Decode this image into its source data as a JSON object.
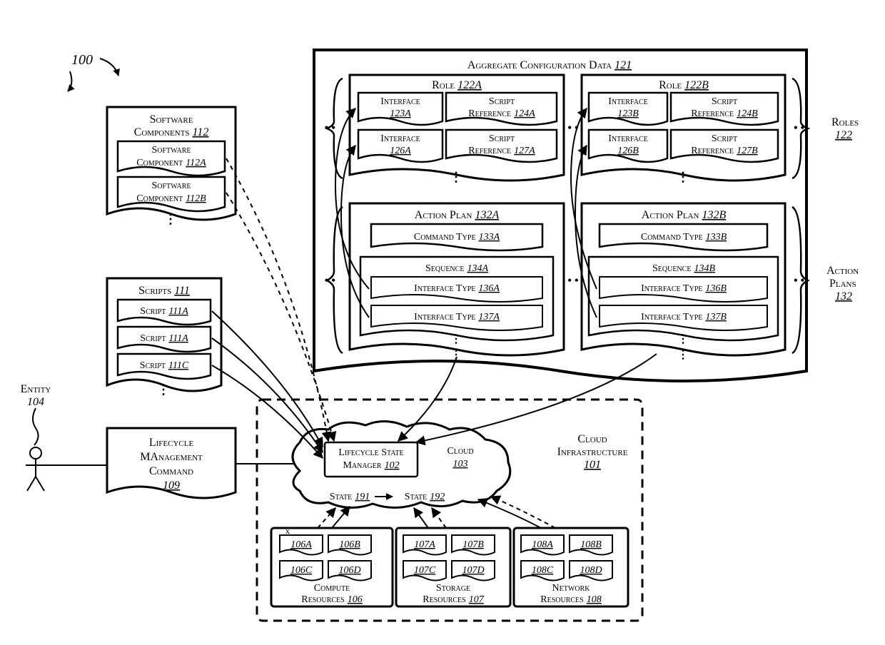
{
  "figure_number_label": "100",
  "entity": {
    "label": "Entity",
    "ref": "104"
  },
  "lifecycle_cmd": {
    "line1": "Lifecycle",
    "line2": "MAnagement",
    "line3": "Command",
    "ref": "109"
  },
  "software_components": {
    "title": "Software",
    "title2": "Components",
    "ref": "112",
    "items": [
      {
        "label1": "Software",
        "label2": "Component",
        "ref": "112A"
      },
      {
        "label1": "Software",
        "label2": "Component",
        "ref": "112B"
      }
    ]
  },
  "scripts": {
    "title": "Scripts",
    "ref": "111",
    "items": [
      {
        "label": "Script",
        "ref": "111A"
      },
      {
        "label": "Script",
        "ref": "111A"
      },
      {
        "label": "Script",
        "ref": "111C"
      }
    ]
  },
  "cloud_infra": {
    "label": "Cloud",
    "label2": "Infrastructure",
    "ref": "101",
    "lsm": {
      "label1": "Lifecycle State",
      "label2": "Manager",
      "ref": "102"
    },
    "cloud": {
      "label": "Cloud",
      "ref": "103"
    },
    "state_from": {
      "label": "State",
      "ref": "191"
    },
    "state_to": {
      "label": "State",
      "ref": "192"
    },
    "compute": {
      "label1": "Compute",
      "label2": "Resources",
      "ref": "106",
      "items": [
        "106A",
        "106B",
        "106C",
        "106D"
      ]
    },
    "storage": {
      "label1": "Storage",
      "label2": "Resources",
      "ref": "107",
      "items": [
        "107A",
        "107B",
        "107C",
        "107D"
      ]
    },
    "network": {
      "label1": "Network",
      "label2": "Resources",
      "ref": "108",
      "items": [
        "108A",
        "108B",
        "108C",
        "108D"
      ]
    }
  },
  "aggregate": {
    "label": "Aggregate Configuration Data",
    "ref": "121",
    "roles_side": {
      "label": "Roles",
      "ref": "122"
    },
    "plans_side": {
      "label1": "Action",
      "label2": "Plans",
      "ref": "132"
    },
    "roles": [
      {
        "title": "Role",
        "ref": "122A",
        "rows": [
          {
            "if_label": "Interface",
            "if_ref": "123A",
            "sr_label1": "Script",
            "sr_label2": "Reference",
            "sr_ref": "124A"
          },
          {
            "if_label": "Interface",
            "if_ref": "126A",
            "sr_label1": "Script",
            "sr_label2": "Reference",
            "sr_ref": "127A"
          }
        ]
      },
      {
        "title": "Role",
        "ref": "122B",
        "rows": [
          {
            "if_label": "Interface",
            "if_ref": "123B",
            "sr_label1": "Script",
            "sr_label2": "Reference",
            "sr_ref": "124B"
          },
          {
            "if_label": "Interface",
            "if_ref": "126B",
            "sr_label1": "Script",
            "sr_label2": "Reference",
            "sr_ref": "127B"
          }
        ]
      }
    ],
    "plans": [
      {
        "title": "Action Plan",
        "ref": "132A",
        "cmd": {
          "label": "Command Type",
          "ref": "133A"
        },
        "seq": {
          "label": "Sequence",
          "ref": "134A",
          "items": [
            {
              "label": "Interface Type",
              "ref": "136A"
            },
            {
              "label": "Interface Type",
              "ref": "137A"
            }
          ]
        }
      },
      {
        "title": "Action Plan",
        "ref": "132B",
        "cmd": {
          "label": "Command Type",
          "ref": "133B"
        },
        "seq": {
          "label": "Sequence",
          "ref": "134B",
          "items": [
            {
              "label": "Interface Type",
              "ref": "136B"
            },
            {
              "label": "Interface Type",
              "ref": "137B"
            }
          ]
        }
      }
    ]
  }
}
